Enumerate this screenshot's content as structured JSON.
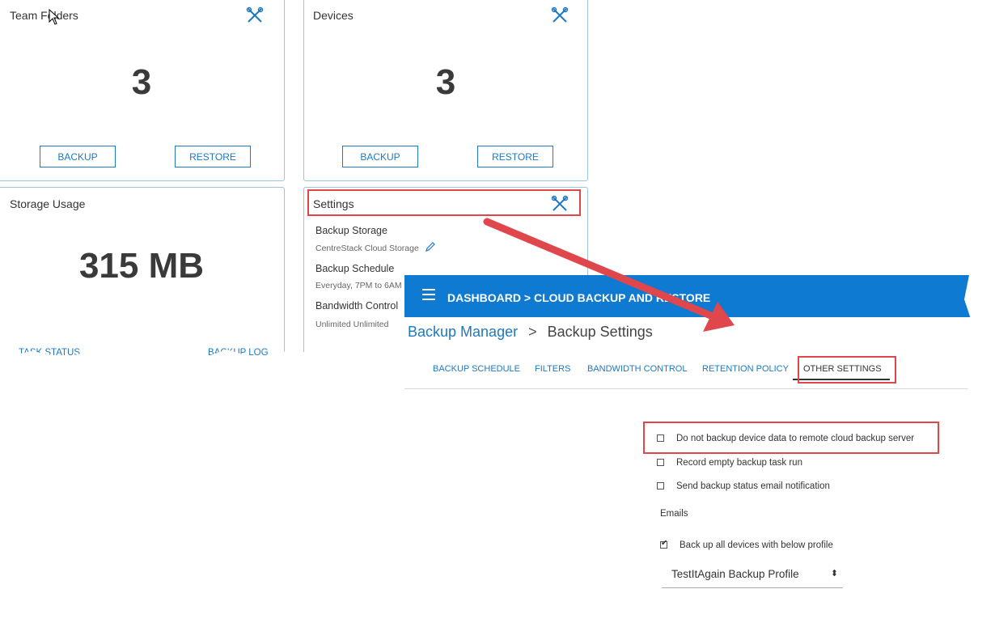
{
  "dashboard": {
    "team_folders": {
      "title": "Team Folders",
      "count": "3",
      "backup": "BACKUP",
      "restore": "RESTORE"
    },
    "devices": {
      "title": "Devices",
      "count": "3",
      "backup": "BACKUP",
      "restore": "RESTORE"
    },
    "storage": {
      "title": "Storage Usage",
      "value": "315 MB",
      "status_link": "TASK STATUS",
      "log_link": "BACKUP LOG"
    },
    "settings": {
      "title": "Settings",
      "backup_storage_label": "Backup Storage",
      "backup_storage_value": "CentreStack Cloud Storage",
      "schedule_label": "Backup Schedule",
      "schedule_value": "Everyday, 7PM to 6AM",
      "bandwidth_label": "Bandwidth Control",
      "bandwidth_value": "Unlimited Unlimited"
    }
  },
  "panel": {
    "topbar_title": "DASHBOARD > CLOUD BACKUP AND RESTORE",
    "breadcrumb": {
      "link": "Backup Manager",
      "sep": ">",
      "current": "Backup Settings"
    },
    "tabs": [
      "BACKUP SCHEDULE",
      "FILTERS",
      "BANDWIDTH CONTROL",
      "RETENTION POLICY",
      "OTHER SETTINGS"
    ],
    "options": [
      {
        "label": "Do not backup device data to remote cloud backup server",
        "checked": false
      },
      {
        "label": "Record empty backup task run",
        "checked": false
      },
      {
        "label": "Send backup status email notification",
        "checked": false
      }
    ],
    "emails_label": "Emails",
    "profile_option": {
      "label": "Back up all devices with below profile",
      "checked": true
    },
    "profile_select": "TestItAgain Backup Profile"
  },
  "colors": {
    "accent": "#1e78c2",
    "topbar": "#0f7ad1",
    "highlight": "#e0474c"
  }
}
